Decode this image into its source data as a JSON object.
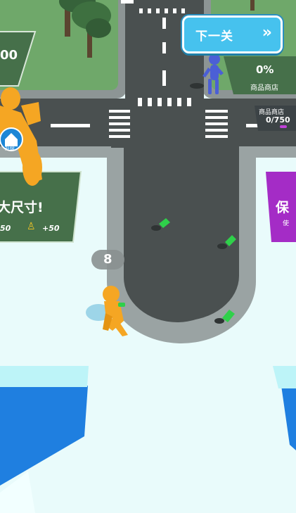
{
  "hud": {
    "next_level_label": "下一关",
    "next_level_icon": "double-chevron-right-icon",
    "shop_percent": "0%",
    "shop_title": "商品商店",
    "shop_sign_title": "商品商店",
    "shop_sign_progress": "0/750",
    "carry_count": "8",
    "left_counter": "00",
    "left_panel_text": "大尺寸!",
    "left_panel_stat_a": "50",
    "left_panel_stat_b": "+50",
    "house_badge_label": "升级",
    "right_panel_text": "保",
    "right_panel_subtext": "使"
  },
  "colors": {
    "road": "#4a5050",
    "curb": "#9aa3a3",
    "grass": "#6fa86a",
    "player": "#f5a623",
    "enemy": "#4b5fd6",
    "money": "#2fd04a",
    "button": "#46c2ee",
    "water": "#1f7fe0",
    "purple_panel": "#a42cc6",
    "green_panel": "#46704a"
  }
}
